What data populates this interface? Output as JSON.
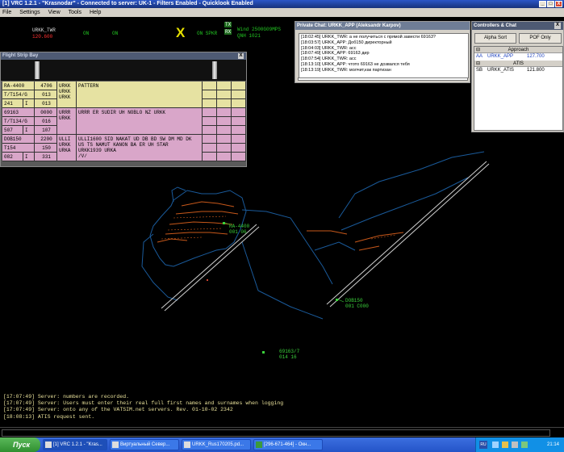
{
  "window": {
    "title": "[1] VRC 1.2.1 - \"Krasnodar\" - Connected to server: UK-1 - Filters Enabled - Quicklook Enabled",
    "min": "_",
    "max": "□",
    "close": "X"
  },
  "menu": [
    "File",
    "Settings",
    "View",
    "Tools",
    "Help"
  ],
  "status": {
    "callsign": "URKK_TWR",
    "freq": "120.600",
    "on1": "ON",
    "on2": "ON",
    "x_marker": "X",
    "on_spkr": "ON SPKR",
    "tx": "TX",
    "rx": "RX",
    "wind": "Wind 2500G09MPS",
    "qnh": "QNH 1021"
  },
  "flight_strip_bay": {
    "title": "Flight Strip Bay",
    "close": "X",
    "strips": [
      {
        "color": "#e6e2a2",
        "callsign": "RA-4400",
        "type": "T/T154/G",
        "cid": "241",
        "rules": "I",
        "squawk": "4706",
        "alt1": "013",
        "alt2": "013",
        "airports": [
          "URKK",
          "URKK",
          "URKK"
        ],
        "route": [
          "PATTERN"
        ]
      },
      {
        "color": "#d9a6c9",
        "callsign": "69163",
        "type": "T/T134/G",
        "cid": "507",
        "rules": "I",
        "squawk": "0000",
        "alt1": "016",
        "alt2": "107",
        "airports": [
          "URRR",
          "URKK"
        ],
        "route": [
          "URRR ER SUDIR UH NOBLO NZ URKK"
        ]
      },
      {
        "color": "#d9a6c9",
        "callsign": "DOB150",
        "type": "T154",
        "cid": "082",
        "rules": "I",
        "squawk": "2200",
        "alt1": "150",
        "alt2": "331",
        "airports": [
          "ULLI",
          "URKK",
          "URKA"
        ],
        "route": [
          "ULLI1600 SID NAKAT UD DB BD SW DM MD DK",
          "US TS NAMUT KANON BA ER UH STAR",
          "URKK1939 URKA",
          "/V/"
        ]
      }
    ]
  },
  "private_chat": {
    "title": "Private Chat: URKK_APP (Aleksandr Karpov)",
    "close": "X",
    "messages": [
      "[18:02:45] URKK_TWR: а не получиться с прямой завести 69163?",
      "[18:03:57] URKK_APP: Доб150 директорный",
      "[18:04:03] URKK_TWR: асс",
      "[18:07:49] URKK_APP: 69163 дир",
      "[18:07:54] URKK_TWR: асс",
      "[18:13:10] URKK_APP: чтото 69163 не дозвался тебя",
      "[18:13:19] URKK_TWR: молчит,как партизан"
    ]
  },
  "controllers": {
    "title": "Controllers & Chat",
    "close": "X",
    "btn_alpha": "Alpha Sort",
    "btn_pof": "POF Only",
    "sections": [
      {
        "name": "Approach",
        "rows": [
          {
            "id": "AA",
            "callsign": "URKK_APP",
            "freq": "127.700"
          }
        ]
      },
      {
        "name": "ATIS",
        "rows": [
          {
            "id": "SB",
            "callsign": "URKK_ATIS",
            "freq": "121.800"
          }
        ]
      }
    ],
    "collapse": "⊟"
  },
  "scope_labels": {
    "ra4400": [
      "RA-4400",
      "001 06"
    ],
    "dob150": [
      "DOB150",
      "001 C000"
    ],
    "f69163": [
      "69163/7",
      "014 16"
    ],
    "runway_label": "Runway"
  },
  "console": [
    "[17:07:49] Server: numbers are recorded.",
    "[17:07:49] Server: Users must enter their real full first names and surnames when logging",
    "[17:07:49] Server: onto any of the VATSIM.net servers. Rev. 01-10-02 2342",
    "[18:08:13] ATIS request sent."
  ],
  "taskbar": {
    "start": "Пуск",
    "buttons": [
      "[1] VRC 1.2.1 - \"Kras...",
      "Виртуальный Север...",
      "URKK_Rus170205.pd...",
      "[296-671-464] - Окн..."
    ],
    "lang": "RU",
    "clock": "21:14"
  },
  "colors": {
    "accent_green": "#22c422",
    "freq_red": "#ff3030",
    "x_yellow": "#e6e000",
    "console_text": "#e8e09a",
    "map_blue": "#1a5a9a"
  }
}
